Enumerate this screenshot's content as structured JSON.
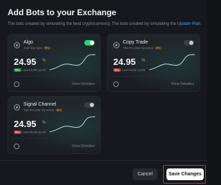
{
  "dialog": {
    "title": "Add Bots to your Exchange",
    "subtitle_prefix": "The bots created by simulating the best cryptocurrency. The bots created by simulating the ",
    "subtitle_link": "Update Plan",
    "subtitle_suffix": "."
  },
  "cards": [
    {
      "name": "Algo",
      "sub": "Just free type",
      "chip": "8%",
      "toggle_on": true,
      "value": "24.95",
      "unit": "%",
      "badge": "8%",
      "badge_dir": "up",
      "period": "Last Month profit",
      "details": "View Detailes"
    },
    {
      "name": "Copy Trade",
      "sub": "The Pro plan by amus",
      "chip": "8%",
      "toggle_on": false,
      "value": "24.95",
      "unit": "%",
      "badge": "8%",
      "badge_dir": "down",
      "period": "Last Month profit",
      "details": "View Detailes"
    },
    {
      "name": "Signal Channel",
      "sub": "The Pro plan by amus",
      "chip": "8%",
      "toggle_on": false,
      "value": "24.95",
      "unit": "%",
      "badge": "8%",
      "badge_dir": "down",
      "period": "Last Month profit",
      "details": "View Detailes"
    }
  ],
  "footer": {
    "cancel_label": "Cancel",
    "save_label": "Save Changes"
  },
  "colors": {
    "accent_green": "#2bd46a",
    "link_blue": "#4aa3f0",
    "highlight_red": "#d8283a"
  }
}
